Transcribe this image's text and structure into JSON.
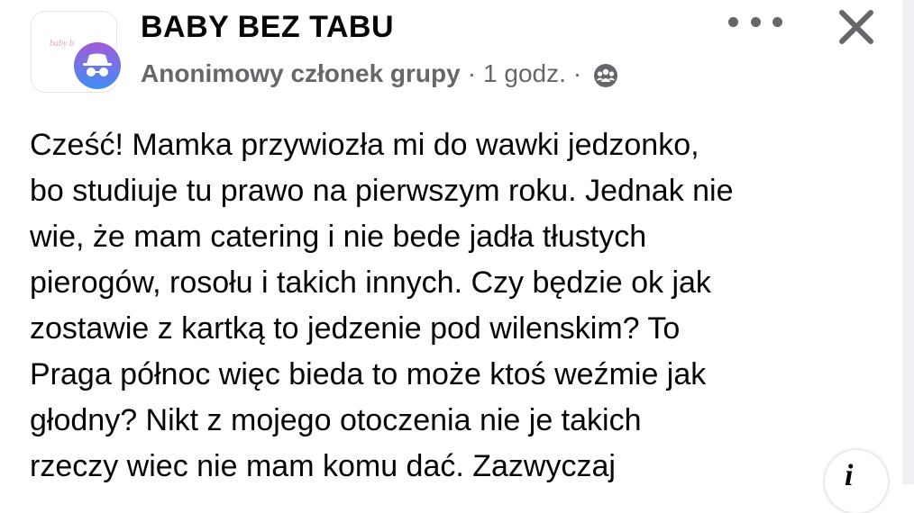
{
  "group": {
    "name": "BABY BEZ TABU",
    "logo_text": "baby b"
  },
  "post_meta": {
    "author": "Anonimowy członek grupy",
    "separator": "·",
    "time": "1 godz.",
    "privacy_icon": "members-icon"
  },
  "actions": {
    "more_icon": "more-options-icon",
    "close_icon": "close-icon",
    "info_icon": "info-icon",
    "info_label": "i"
  },
  "post": {
    "text": "Cześć! Mamka przywiozła mi do wawki jedzonko,\nbo studiuje tu prawo na pierwszym roku. Jednak nie\nwie, że mam catering i nie bede jadła tłustych\npierogów, rosołu i takich innych.  Czy będzie ok jak\nzostawie z kartką to jedzenie pod wilenskim? To\nPraga północ więc bieda to może ktoś weźmie jak\ngłodny? Nikt z mojego otoczenia nie je takich\nrzeczy wiec nie mam komu dać. Zazwyczaj"
  },
  "colors": {
    "secondary_text": "#65676b",
    "anon_avatar_purple": "#8e5cd9",
    "anon_avatar_blue": "#3f8ef7"
  }
}
